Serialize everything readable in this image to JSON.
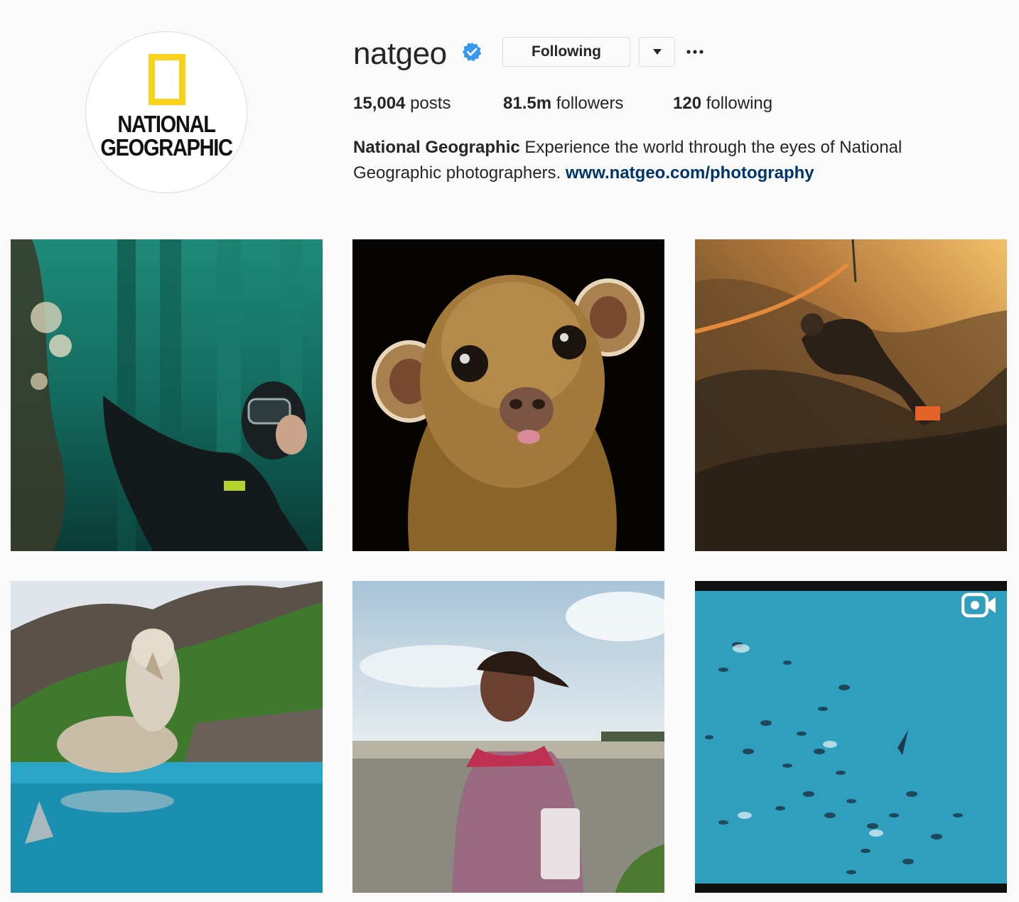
{
  "profile": {
    "username": "natgeo",
    "verified": true,
    "follow_button_label": "Following",
    "avatar": {
      "logo_line1": "NATIONAL",
      "logo_line2": "GEOGRAPHIC",
      "frame_color": "#f8d21c"
    },
    "stats": {
      "posts_count": "15,004",
      "posts_label": "posts",
      "followers_count": "81.5m",
      "followers_label": "followers",
      "following_count": "120",
      "following_label": "following"
    },
    "bio": {
      "name": "National Geographic",
      "text": " Experience the world through the eyes of National Geographic photographers. ",
      "link": "www.natgeo.com/photography"
    }
  },
  "icons": {
    "verified": "verified-badge-icon",
    "dropdown": "caret-down-icon",
    "more": "ellipsis-icon",
    "video": "video-camera-icon"
  },
  "colors": {
    "verified_blue": "#3897f0",
    "link": "#003569",
    "background": "#fafafa"
  },
  "grid": {
    "posts": [
      {
        "subject": "diver-underwater-kelp"
      },
      {
        "subject": "kinkajou-portrait"
      },
      {
        "subject": "climber-on-rope-sunset"
      },
      {
        "subject": "giant-petrel-split-water"
      },
      {
        "subject": "girl-on-beach"
      },
      {
        "subject": "aerial-dolphins",
        "type": "video"
      }
    ]
  }
}
